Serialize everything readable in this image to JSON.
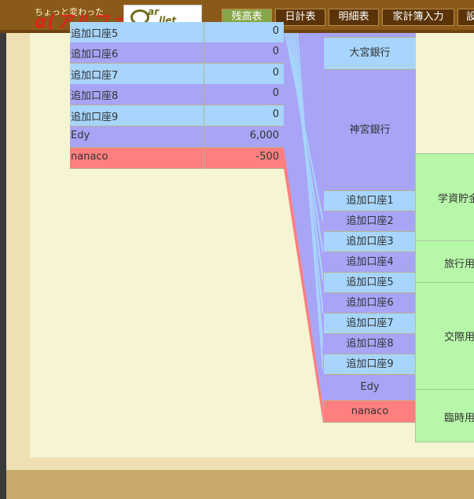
{
  "header": {
    "brand_small": "ちょっと変わった",
    "brand_big": "α(アルファ)版",
    "logo_line1": "ar",
    "logo_line2": "llet",
    "nav": [
      {
        "label": "残高表",
        "active": true
      },
      {
        "label": "日計表",
        "active": false
      },
      {
        "label": "明細表",
        "active": false
      },
      {
        "label": "家計簿入力",
        "active": false
      },
      {
        "label": "設",
        "active": false
      }
    ]
  },
  "accounts": [
    {
      "name": "追加口座5",
      "value": "0",
      "color": "blue"
    },
    {
      "name": "追加口座6",
      "value": "0",
      "color": "purple"
    },
    {
      "name": "追加口座7",
      "value": "0",
      "color": "blue"
    },
    {
      "name": "追加口座8",
      "value": "0",
      "color": "purple"
    },
    {
      "name": "追加口座9",
      "value": "0",
      "color": "blue"
    },
    {
      "name": "Edy",
      "value": "6,000",
      "color": "purple"
    },
    {
      "name": "nanaco",
      "value": "-500",
      "color": "red"
    }
  ],
  "banks": [
    {
      "label": "",
      "color": "purple"
    },
    {
      "label": "大宮銀行",
      "color": "blue"
    },
    {
      "label": "神宮銀行",
      "color": "purple"
    },
    {
      "label": "追加口座1",
      "color": "blue"
    },
    {
      "label": "追加口座2",
      "color": "purple"
    },
    {
      "label": "追加口座3",
      "color": "blue"
    },
    {
      "label": "追加口座4",
      "color": "purple"
    },
    {
      "label": "追加口座5",
      "color": "blue"
    },
    {
      "label": "追加口座6",
      "color": "purple"
    },
    {
      "label": "追加口座7",
      "color": "blue"
    },
    {
      "label": "追加口座8",
      "color": "purple"
    },
    {
      "label": "追加口座9",
      "color": "blue"
    },
    {
      "label": "Edy",
      "color": "purple"
    },
    {
      "label": "nanaco",
      "color": "red"
    }
  ],
  "purposes": [
    {
      "label": "学資貯金"
    },
    {
      "label": "旅行用"
    },
    {
      "label": "交際用"
    },
    {
      "label": "臨時用"
    }
  ],
  "colors": {
    "blue": "#a7d5fb",
    "purple": "#a8a5f7",
    "red": "#ff7f7f",
    "green": "#b7f7a9",
    "header_brown": "#8a5a18",
    "nav_active": "#86a648"
  }
}
